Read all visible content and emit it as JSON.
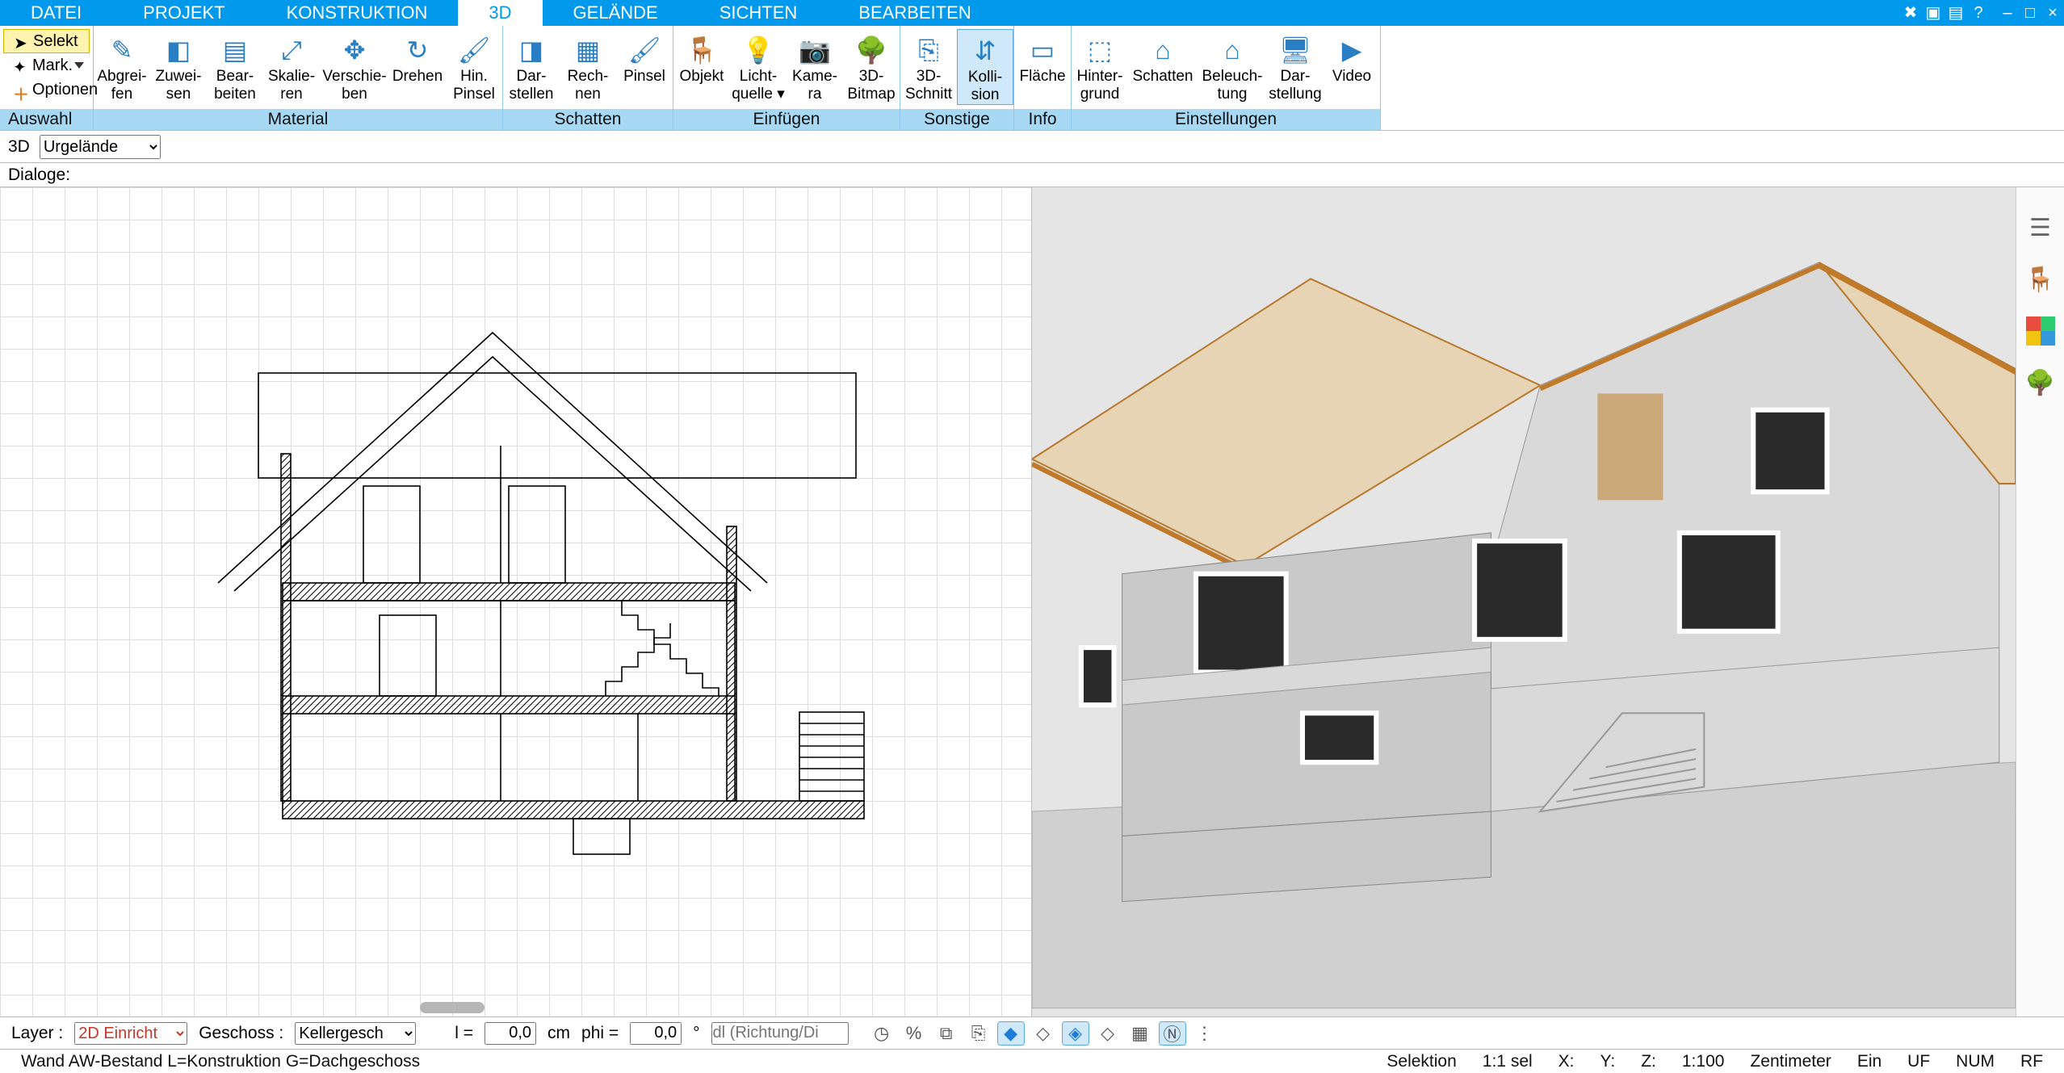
{
  "menu": {
    "tabs": [
      "DATEI",
      "PROJEKT",
      "KONSTRUKTION",
      "3D",
      "GELÄNDE",
      "SICHTEN",
      "BEARBEITEN"
    ],
    "active": 3
  },
  "selection_group": {
    "caption": "Auswahl",
    "select": "Selekt",
    "mark": "Mark.",
    "options": "Optionen"
  },
  "ribbon": [
    {
      "caption": "Material",
      "buttons": [
        {
          "id": "abgreifen",
          "l1": "Abgrei-",
          "l2": "fen",
          "icon": "✎"
        },
        {
          "id": "zuweisen",
          "l1": "Zuwei-",
          "l2": "sen",
          "icon": "◧"
        },
        {
          "id": "bearbeiten",
          "l1": "Bear-",
          "l2": "beiten",
          "icon": "▤"
        },
        {
          "id": "skalieren",
          "l1": "Skalie-",
          "l2": "ren",
          "icon": "⤢"
        },
        {
          "id": "verschieben",
          "l1": "Verschie-",
          "l2": "ben",
          "icon": "✥"
        },
        {
          "id": "drehen",
          "l1": "Drehen",
          "l2": "",
          "icon": "↻"
        },
        {
          "id": "hin-pinsel",
          "l1": "Hin.",
          "l2": "Pinsel",
          "icon": "🖌"
        }
      ]
    },
    {
      "caption": "Schatten",
      "buttons": [
        {
          "id": "darstellen",
          "l1": "Dar-",
          "l2": "stellen",
          "icon": "◨"
        },
        {
          "id": "rechnen",
          "l1": "Rech-",
          "l2": "nen",
          "icon": "▦"
        },
        {
          "id": "pinsel",
          "l1": "Pinsel",
          "l2": "",
          "icon": "🖌"
        }
      ]
    },
    {
      "caption": "Einfügen",
      "buttons": [
        {
          "id": "objekt",
          "l1": "Objekt",
          "l2": "",
          "icon": "🪑"
        },
        {
          "id": "lichtquelle",
          "l1": "Licht-",
          "l2": "quelle ▾",
          "icon": "💡"
        },
        {
          "id": "kamera",
          "l1": "Kame-",
          "l2": "ra",
          "icon": "📷"
        },
        {
          "id": "3d-bitmap",
          "l1": "3D-",
          "l2": "Bitmap",
          "icon": "🌳"
        }
      ]
    },
    {
      "caption": "Sonstige",
      "buttons": [
        {
          "id": "3d-schnitt",
          "l1": "3D-",
          "l2": "Schnitt",
          "icon": "⎘"
        },
        {
          "id": "kollision",
          "l1": "Kolli-",
          "l2": "sion",
          "icon": "⇵",
          "active": true
        }
      ]
    },
    {
      "caption": "Info",
      "buttons": [
        {
          "id": "flaeche",
          "l1": "Fläche",
          "l2": "",
          "icon": "▭"
        }
      ]
    },
    {
      "caption": "Einstellungen",
      "buttons": [
        {
          "id": "hintergrund",
          "l1": "Hinter-",
          "l2": "grund",
          "icon": "⬚"
        },
        {
          "id": "schatten-set",
          "l1": "Schatten",
          "l2": "",
          "icon": "⌂"
        },
        {
          "id": "beleuchtung",
          "l1": "Beleuch-",
          "l2": "tung",
          "icon": "⌂"
        },
        {
          "id": "darstellung",
          "l1": "Dar-",
          "l2": "stellung",
          "icon": "🖥"
        },
        {
          "id": "video",
          "l1": "Video",
          "l2": "",
          "icon": "▶"
        }
      ]
    }
  ],
  "viewbar": {
    "label": "3D",
    "dropdown": "Urgelände"
  },
  "dialogbar": {
    "label": "Dialoge:"
  },
  "side": [
    "layers-icon",
    "chair-icon",
    "palette-icon",
    "tree-icon"
  ],
  "toolbar2": {
    "layer_label": "Layer :",
    "layer_value": "2D Einricht",
    "geschoss_label": "Geschoss :",
    "geschoss_value": "Kellergesch",
    "len_label": "l =",
    "len_value": "0,0",
    "len_unit": "cm",
    "phi_label": "phi =",
    "phi_value": "0,0",
    "phi_unit": "°",
    "direction_placeholder": "dl (Richtung/Di",
    "icons": [
      "clock",
      "percent",
      "group",
      "copy",
      "blue3d",
      "layer1",
      "layer2",
      "layer3",
      "grid",
      "north",
      "more"
    ]
  },
  "status": {
    "hint": "Wand AW-Bestand L=Konstruktion G=Dachgeschoss",
    "selection": "Selektion",
    "selcount": "1:1 sel",
    "x": "X:",
    "y": "Y:",
    "z": "Z:",
    "scale": "1:100",
    "unit": "Zentimeter",
    "on": "Ein",
    "uf": "UF",
    "num": "NUM",
    "rf": "RF"
  }
}
